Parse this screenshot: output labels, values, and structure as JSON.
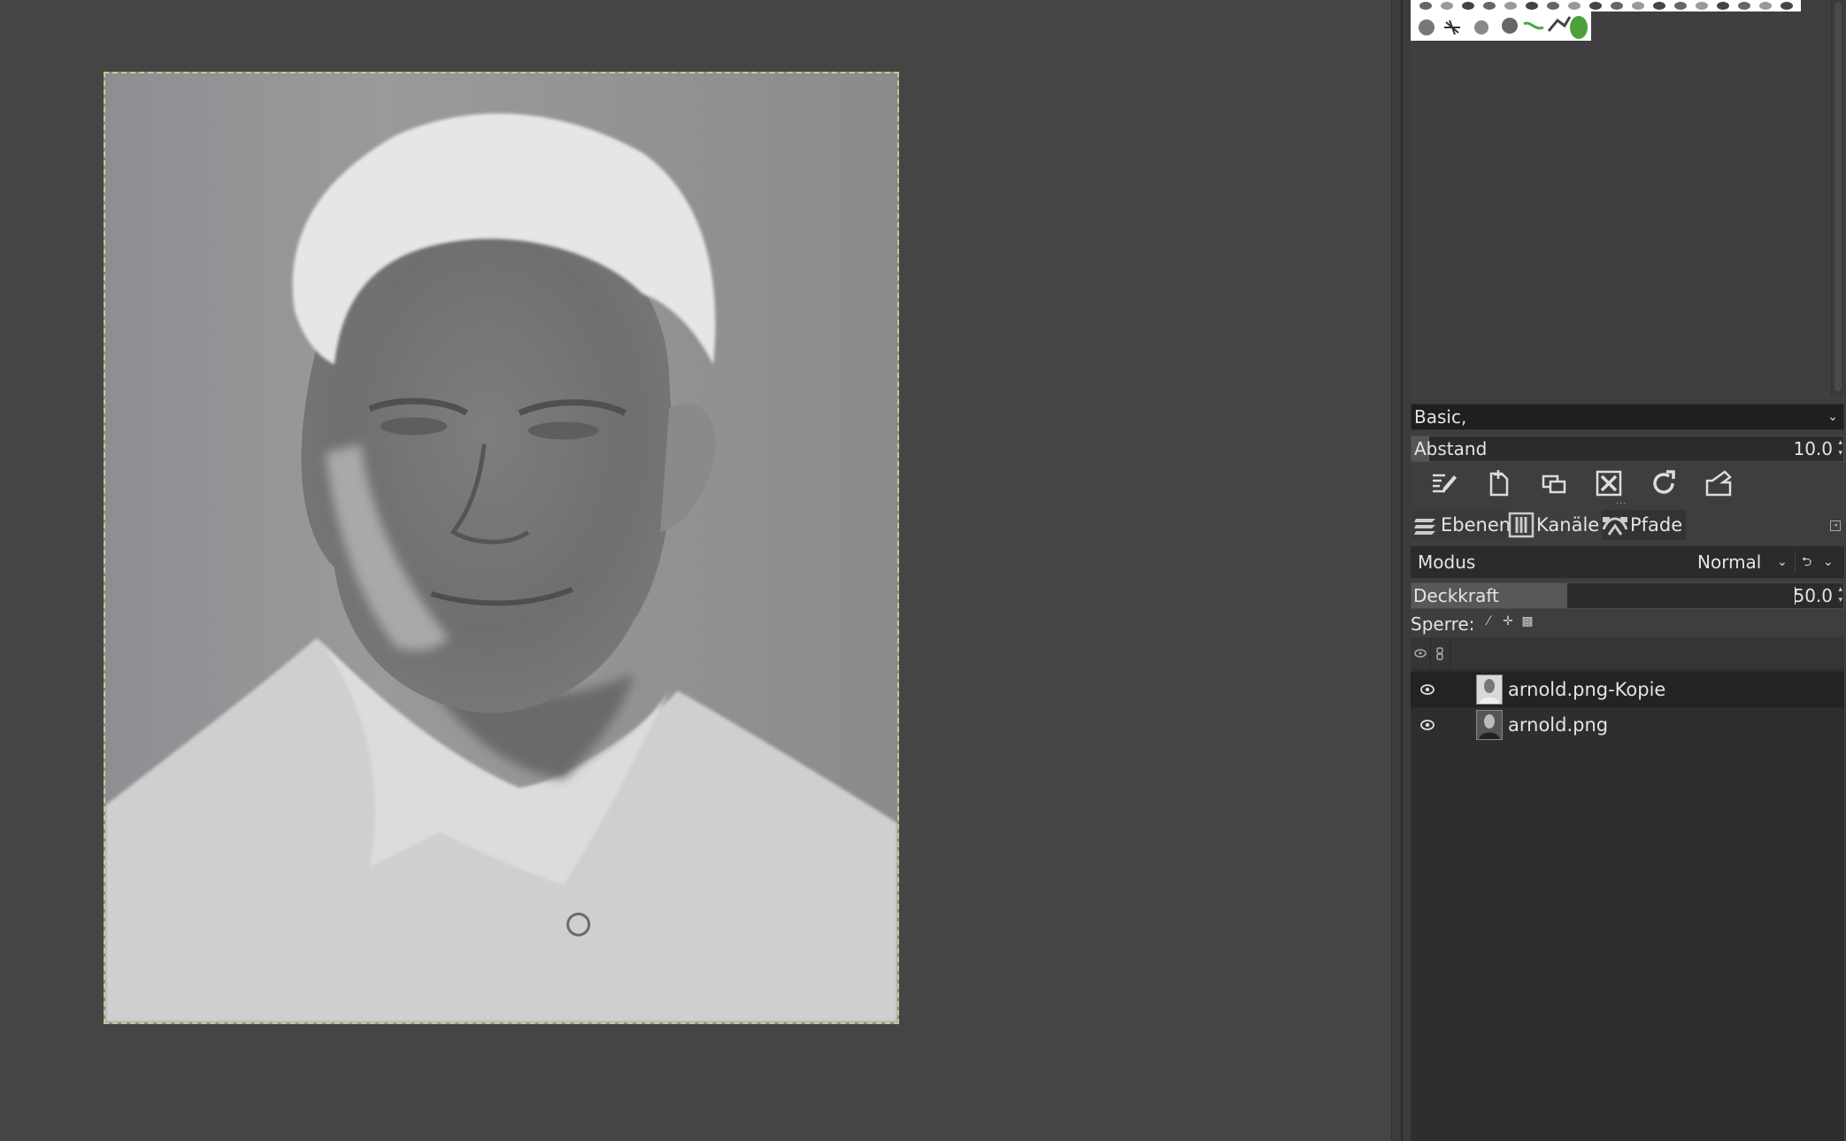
{
  "canvas": {
    "image_description_alt": ""
  },
  "brushes": {
    "set_name": "Basic,",
    "spacing_label": "Abstand",
    "spacing_value": "10.0"
  },
  "toolbar": {
    "icons": [
      "edit-brush-icon",
      "new-brush-icon",
      "duplicate-brush-icon",
      "delete-brush-icon",
      "refresh-brushes-icon",
      "open-brush-folder-icon"
    ]
  },
  "tabs": [
    {
      "label": "Ebenen",
      "icon": "layers-icon"
    },
    {
      "label": "Kanäle",
      "icon": "channels-icon"
    },
    {
      "label": "Pfade",
      "icon": "paths-icon"
    }
  ],
  "layers_panel": {
    "mode_label": "Modus",
    "mode_value": "Normal",
    "opacity_label": "Deckkraft",
    "opacity_value": "50.0",
    "opacity_fraction": 0.5,
    "lock_label": "Sperre:",
    "layers": [
      {
        "name": "arnold.png-Kopie",
        "selected": true,
        "visible": true
      },
      {
        "name": "arnold.png",
        "selected": false,
        "visible": true
      }
    ]
  },
  "colors": {
    "background": "#454545",
    "dock": "#3e3e3e",
    "selected_row": "#232323",
    "canvas_border": "#c9c98a"
  }
}
